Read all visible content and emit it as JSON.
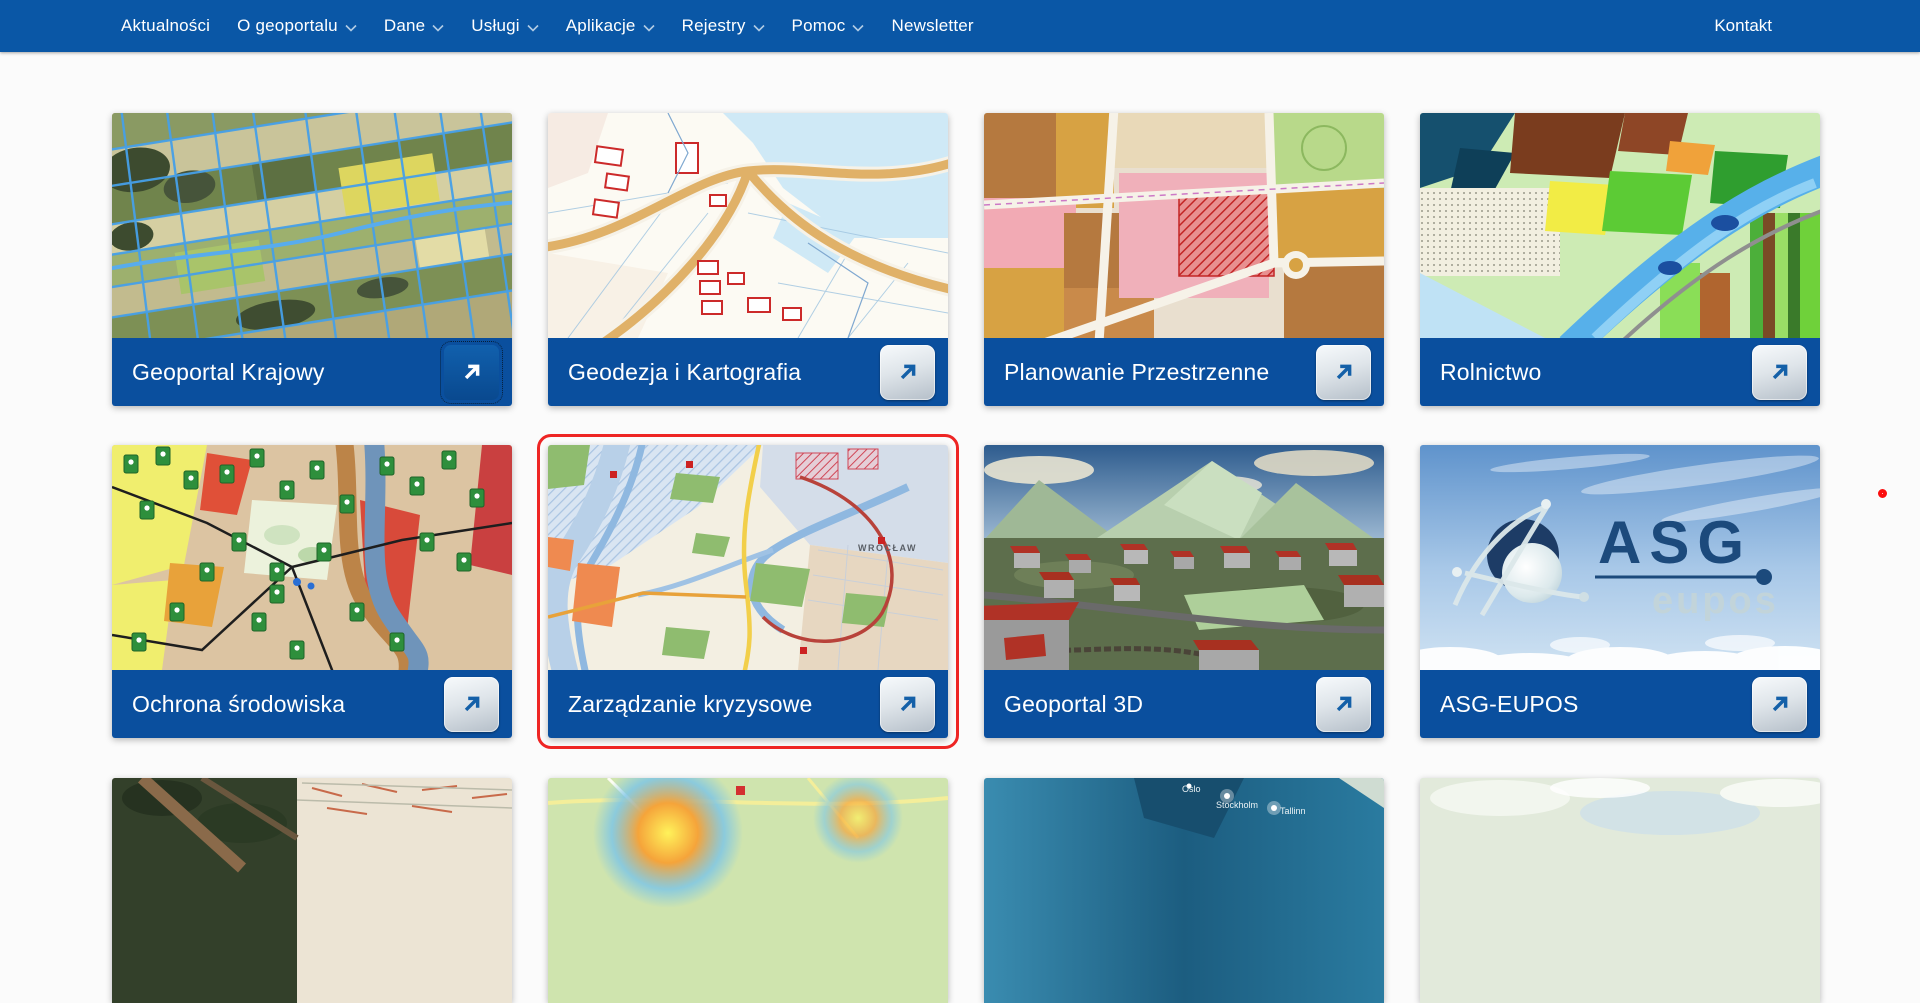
{
  "navbar": {
    "background": "#0a57a6",
    "items": [
      {
        "label": "Aktualności",
        "has_dropdown": false
      },
      {
        "label": "O geoportalu",
        "has_dropdown": true
      },
      {
        "label": "Dane",
        "has_dropdown": true
      },
      {
        "label": "Usługi",
        "has_dropdown": true
      },
      {
        "label": "Aplikacje",
        "has_dropdown": true
      },
      {
        "label": "Rejestry",
        "has_dropdown": true
      },
      {
        "label": "Pomoc",
        "has_dropdown": true
      },
      {
        "label": "Newsletter",
        "has_dropdown": false
      }
    ],
    "kontakt_label": "Kontakt"
  },
  "cards": [
    {
      "title": "Geoportal Krajowy",
      "button_state": "focused"
    },
    {
      "title": "Geodezja i Kartografia",
      "button_state": "normal"
    },
    {
      "title": "Planowanie Przestrzenne",
      "button_state": "normal"
    },
    {
      "title": "Rolnictwo",
      "button_state": "normal"
    },
    {
      "title": "Ochrona środowiska",
      "button_state": "normal"
    },
    {
      "title": "Zarządzanie kryzysowe",
      "button_state": "normal",
      "highlighted": true,
      "map_label": "WROCŁAW"
    },
    {
      "title": "Geoportal 3D",
      "button_state": "normal"
    },
    {
      "title": "ASG-EUPOS",
      "button_state": "normal",
      "logo": {
        "line1": "ASG",
        "line2": "eupos"
      }
    }
  ],
  "partial_row_tiles": [
    {
      "kind": "orthophoto-city-map"
    },
    {
      "kind": "heatmap"
    },
    {
      "kind": "baltic-sea-map",
      "labels": [
        "Oslo",
        "Stockholm",
        "Tallinn"
      ]
    },
    {
      "kind": "pale-satellite"
    }
  ],
  "annotations": {
    "red_ring_marker": true
  },
  "icons": {
    "external_link": "arrow-up-right",
    "dropdown": "chevron-down"
  },
  "colors": {
    "nav_blue": "#0a57a6",
    "bar_blue": "#0a4f9e",
    "highlight_red": "#ee2524",
    "button_silver_top": "#f7fafc",
    "button_silver_bottom": "#b5bfc9",
    "arrow_blue": "#1460a8",
    "page_background": "#fbfbfb"
  }
}
